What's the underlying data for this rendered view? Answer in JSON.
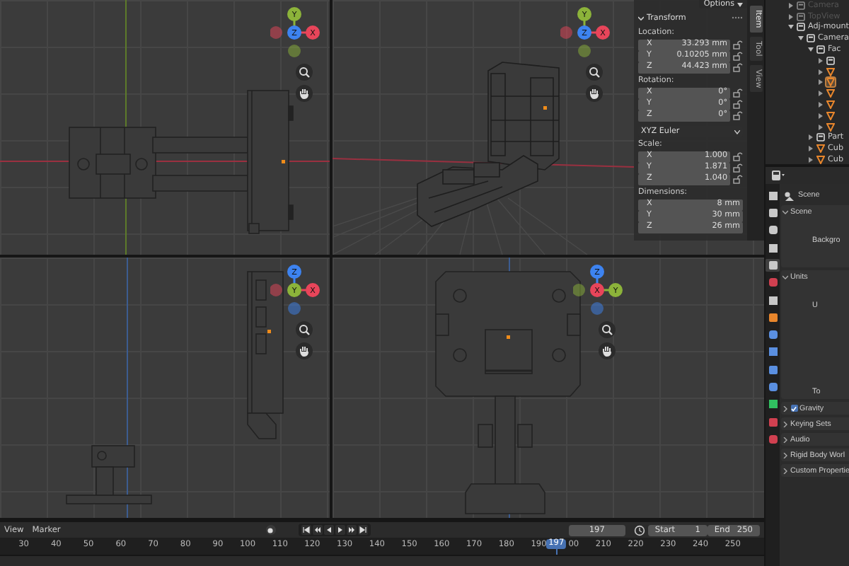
{
  "viewports": [
    {
      "gizmo": [
        {
          "label": "Y",
          "color": "#8cb33a"
        },
        {
          "label": "Z",
          "color": "#3d83f0"
        },
        {
          "label": "X",
          "color": "#e8455a"
        }
      ]
    },
    {
      "gizmo": [
        {
          "label": "Y",
          "color": "#8cb33a"
        },
        {
          "label": "Z",
          "color": "#3d83f0"
        },
        {
          "label": "X",
          "color": "#e8455a"
        }
      ]
    },
    {
      "gizmo": [
        {
          "label": "Z",
          "color": "#3d83f0"
        },
        {
          "label": "Y",
          "color": "#8cb33a"
        },
        {
          "label": "X",
          "color": "#e8455a"
        }
      ]
    },
    {
      "gizmo": [
        {
          "label": "Z",
          "color": "#3d83f0"
        },
        {
          "label": "X",
          "color": "#e8455a"
        },
        {
          "label": "Y",
          "color": "#8cb33a"
        }
      ]
    }
  ],
  "sidebar": {
    "options": "Options",
    "title": "Transform",
    "expanded": true,
    "sections": [
      {
        "label": "Location:",
        "fields": [
          {
            "axis": "X",
            "value": "33.293 mm",
            "locked": false
          },
          {
            "axis": "Y",
            "value": "0.10205 mm",
            "locked": false
          },
          {
            "axis": "Z",
            "value": "44.423 mm",
            "locked": false
          }
        ]
      },
      {
        "label": "Rotation:",
        "fields": [
          {
            "axis": "X",
            "value": "0°",
            "locked": false
          },
          {
            "axis": "Y",
            "value": "0°",
            "locked": false
          },
          {
            "axis": "Z",
            "value": "0°",
            "locked": false
          }
        ],
        "mode": "XYZ Euler"
      },
      {
        "label": "Scale:",
        "fields": [
          {
            "axis": "X",
            "value": "1.000",
            "locked": false
          },
          {
            "axis": "Y",
            "value": "1.871",
            "locked": false
          },
          {
            "axis": "Z",
            "value": "1.040",
            "locked": false
          }
        ]
      },
      {
        "label": "Dimensions:",
        "fields": [
          {
            "axis": "X",
            "value": "8 mm"
          },
          {
            "axis": "Y",
            "value": "30 mm"
          },
          {
            "axis": "Z",
            "value": "26 mm"
          }
        ]
      }
    ],
    "tabs": [
      {
        "label": "Item",
        "selected": true
      },
      {
        "label": "Tool",
        "selected": false
      },
      {
        "label": "View",
        "selected": false
      }
    ]
  },
  "outliner": {
    "items": [
      {
        "label": "Camera",
        "kind": "collection",
        "expanded": false,
        "excluded": true,
        "selected": false
      },
      {
        "label": "TopView",
        "kind": "collection",
        "expanded": false,
        "excluded": true,
        "selected": false
      },
      {
        "label": "Adj-mount",
        "kind": "collection",
        "expanded": true,
        "excluded": false,
        "selected": false,
        "children": [
          {
            "label": "Camera",
            "kind": "collection",
            "expanded": true,
            "excluded": false,
            "selected": false,
            "children": [
              {
                "label": "Fac",
                "kind": "collection",
                "expanded": true,
                "excluded": false,
                "selected": false,
                "children": [
                  {
                    "kind": "collection",
                    "expanded": false,
                    "excluded": false,
                    "selected": false
                  },
                  {
                    "kind": "mesh",
                    "expanded": false,
                    "excluded": false,
                    "selected": false
                  },
                  {
                    "kind": "mesh",
                    "expanded": false,
                    "excluded": false,
                    "selected": true
                  },
                  {
                    "kind": "mesh",
                    "expanded": false,
                    "excluded": false,
                    "selected": false
                  },
                  {
                    "kind": "mesh",
                    "expanded": false,
                    "excluded": false,
                    "selected": false
                  },
                  {
                    "kind": "mesh",
                    "expanded": false,
                    "excluded": false,
                    "selected": false
                  },
                  {
                    "kind": "mesh",
                    "expanded": false,
                    "excluded": false,
                    "selected": false
                  }
                ]
              },
              {
                "label": "Part",
                "kind": "collection",
                "expanded": false,
                "excluded": false,
                "selected": false
              },
              {
                "label": "Cub",
                "kind": "mesh",
                "expanded": false,
                "excluded": false,
                "selected": false
              },
              {
                "label": "Cub",
                "kind": "mesh",
                "expanded": false,
                "excluded": false,
                "selected": false
              }
            ]
          }
        ]
      }
    ]
  },
  "properties": {
    "tabs": [
      {
        "color": "#c8c8c8",
        "selected": false
      },
      {
        "color": "#c8c8c8",
        "selected": false
      },
      {
        "color": "#c8c8c8",
        "selected": false
      },
      {
        "color": "#c8c8c8",
        "selected": false
      },
      {
        "color": "#c8c8c8",
        "selected": true
      },
      {
        "color": "#d04050",
        "selected": false
      },
      {
        "color": "#c8c8c8",
        "selected": false
      },
      {
        "color": "#e8862c",
        "selected": false
      },
      {
        "color": "#5a8fe0",
        "selected": false
      },
      {
        "color": "#5a8fe0",
        "selected": false
      },
      {
        "color": "#5a8fe0",
        "selected": false
      },
      {
        "color": "#5a8fe0",
        "selected": false
      },
      {
        "color": "#30c060",
        "selected": false
      },
      {
        "color": "#d04050",
        "selected": false
      },
      {
        "color": "#d04050",
        "selected": false
      }
    ],
    "title": "Scene",
    "panels": [
      {
        "kind": "open",
        "title": "Scene",
        "expanded": true,
        "labels": [
          "Backgro"
        ]
      },
      {
        "kind": "open",
        "title": "Units",
        "expanded": true,
        "labels": [
          "U",
          "To"
        ]
      },
      {
        "kind": "check",
        "title": "Gravity",
        "expanded": false,
        "checked": true
      },
      {
        "kind": "plain",
        "title": "Keying Sets",
        "expanded": false
      },
      {
        "kind": "plain",
        "title": "Audio",
        "expanded": false
      },
      {
        "kind": "plain",
        "title": "Rigid Body Worl",
        "expanded": false
      },
      {
        "kind": "plain",
        "title": "Custom Propertie",
        "expanded": false
      }
    ]
  },
  "timeline": {
    "menus": [
      "View",
      "Marker"
    ],
    "frame": "197",
    "start_label": "Start",
    "start": "1",
    "end_label": "End",
    "end": "250",
    "ruler": [
      "30",
      "40",
      "50",
      "60",
      "70",
      "80",
      "90",
      "100",
      "110",
      "120",
      "130",
      "140",
      "150",
      "160",
      "170",
      "180",
      "190",
      "00",
      "210",
      "220",
      "230",
      "240",
      "250"
    ],
    "playhead": {
      "label": "197",
      "level": 0.728
    }
  }
}
